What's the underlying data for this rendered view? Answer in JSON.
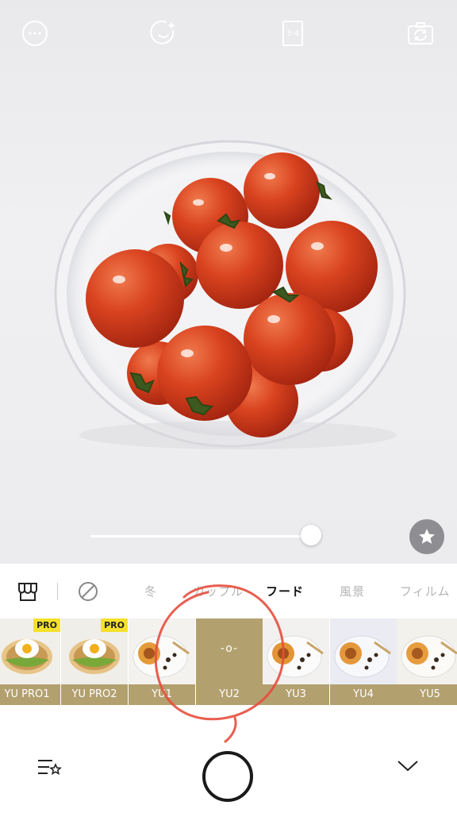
{
  "top_bar": {
    "more_icon": "ellipsis-circle-icon",
    "beauty_icon": "face-sparkle-icon",
    "aspect_ratio": "3:4",
    "switch_camera_icon": "camera-flip-icon"
  },
  "slider": {
    "value": 0.96
  },
  "favorite_icon": "star-icon",
  "category_bar": {
    "tabs": [
      {
        "label": "冬"
      },
      {
        "label": "カップル"
      },
      {
        "label": "フード"
      },
      {
        "label": "風景"
      },
      {
        "label": "フィルム"
      }
    ],
    "active_tab": "フード"
  },
  "filters": [
    {
      "label": "YU PRO1",
      "pro_badge": "PRO"
    },
    {
      "label": "YU PRO2",
      "pro_badge": "PRO"
    },
    {
      "label": "YU1"
    },
    {
      "label": "YU2",
      "selected_mark": "-o-"
    },
    {
      "label": "YU3"
    },
    {
      "label": "YU4"
    },
    {
      "label": "YU5"
    }
  ],
  "colors": {
    "accent": "#b3a06f",
    "pro_badge": "#f5e12b",
    "annotation": "#e74c3c"
  },
  "bottom_bar": {
    "filter_list_icon": "list-star-icon",
    "shutter_icon": "shutter-button",
    "collapse_icon": "chevron-down-icon"
  }
}
